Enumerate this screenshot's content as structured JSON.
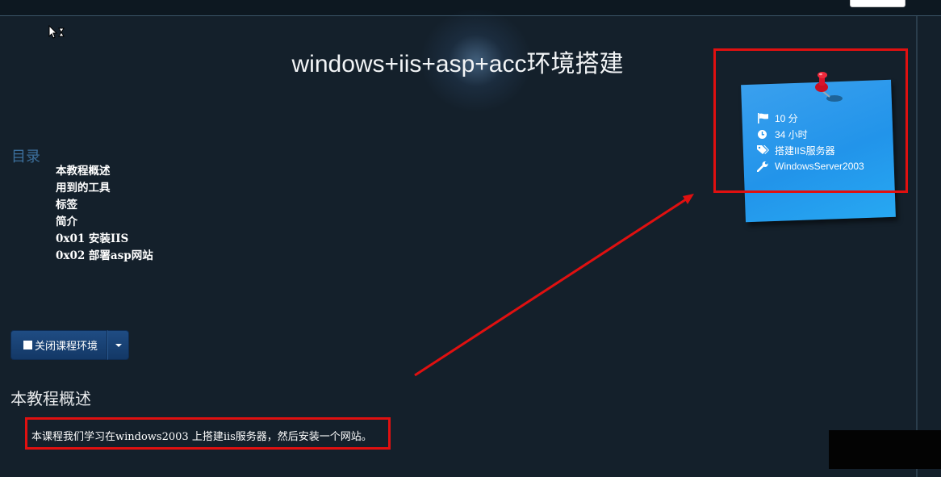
{
  "page": {
    "title": "windows+iis+asp+acc环境搭建"
  },
  "toc": {
    "heading": "目录",
    "items": [
      "本教程概述",
      "用到的工具",
      "标签",
      "简介",
      "0x01 安装IIS",
      "0x02 部署asp网站"
    ]
  },
  "course_button": {
    "label": "关闭课程环境",
    "icon": "stop-square-icon"
  },
  "overview": {
    "heading": "本教程概述",
    "text": "本课程我们学习在windows2003 上搭建iis服务器，然后安装一个网站。"
  },
  "sticky_note": {
    "color": "#2294ea",
    "items": [
      {
        "icon": "flag-icon",
        "text": "10 分"
      },
      {
        "icon": "clock-icon",
        "text": "34 小时"
      },
      {
        "icon": "tags-icon",
        "text": "搭建IIS服务器"
      },
      {
        "icon": "wrench-icon",
        "text": "WindowsServer2003"
      }
    ]
  },
  "annotation_color": "#e01010"
}
